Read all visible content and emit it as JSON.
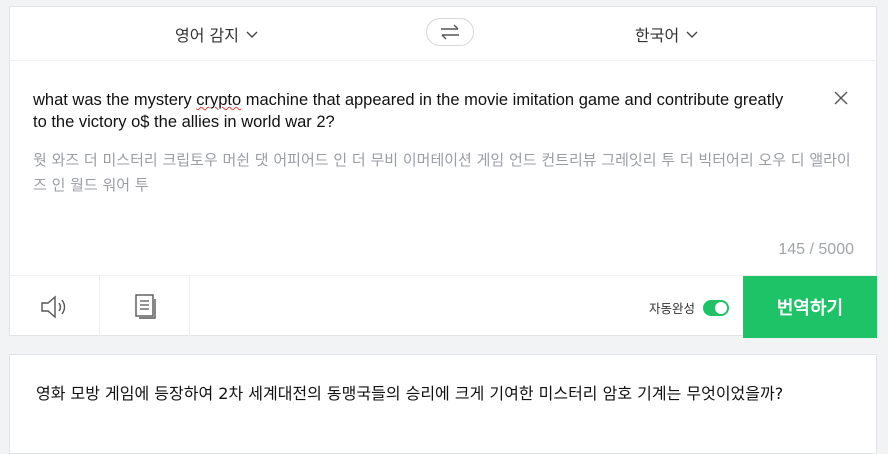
{
  "source_lang": {
    "label": "영어 감지"
  },
  "target_lang": {
    "label": "한국어"
  },
  "input": {
    "text_before": "what was the mystery ",
    "misspelled": "crypto",
    "text_after": " machine that appeared in the movie imitation game and contribute greatly to the victory o$ the allies in world war 2?",
    "pronunciation": "웟 와즈 더 미스터리 크립토우 머쉰 댓 어피어드 인 더 무비 이머테이션 게임 언드 컨트리뷰 그레잇리 투 더 빅터어리 오우 디 앨라이즈 인 월드 워어 투",
    "counter": "145 / 5000"
  },
  "toolbar": {
    "autocomplete_label": "자동완성",
    "autocomplete_on": true,
    "translate_label": "번역하기"
  },
  "icons": {
    "swap": "swap-arrows-icon",
    "close": "close-icon",
    "speaker": "speaker-icon",
    "copy": "copy-icon",
    "chevron": "chevron-down-icon"
  },
  "colors": {
    "accent": "#1ec267"
  },
  "output": {
    "text": "영화 모방 게임에 등장하여 2차 세계대전의 동맹국들의 승리에 크게 기여한 미스터리 암호 기계는 무엇이었을까?"
  }
}
